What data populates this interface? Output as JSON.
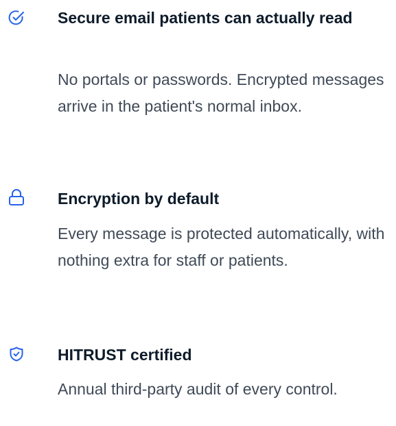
{
  "accent_color": "#2563eb",
  "features": [
    {
      "icon": "check-badge-icon",
      "title": "Secure email patients can actually read",
      "description": "No portals or passwords. Encrypted messages arrive in the patient's normal inbox."
    },
    {
      "icon": "lock-icon",
      "title": "Encryption by default",
      "description": "Every message is protected automatically, with nothing extra for staff or patients."
    },
    {
      "icon": "shield-check-icon",
      "title": "HITRUST certified",
      "description": "Annual third-party audit of every control."
    }
  ]
}
